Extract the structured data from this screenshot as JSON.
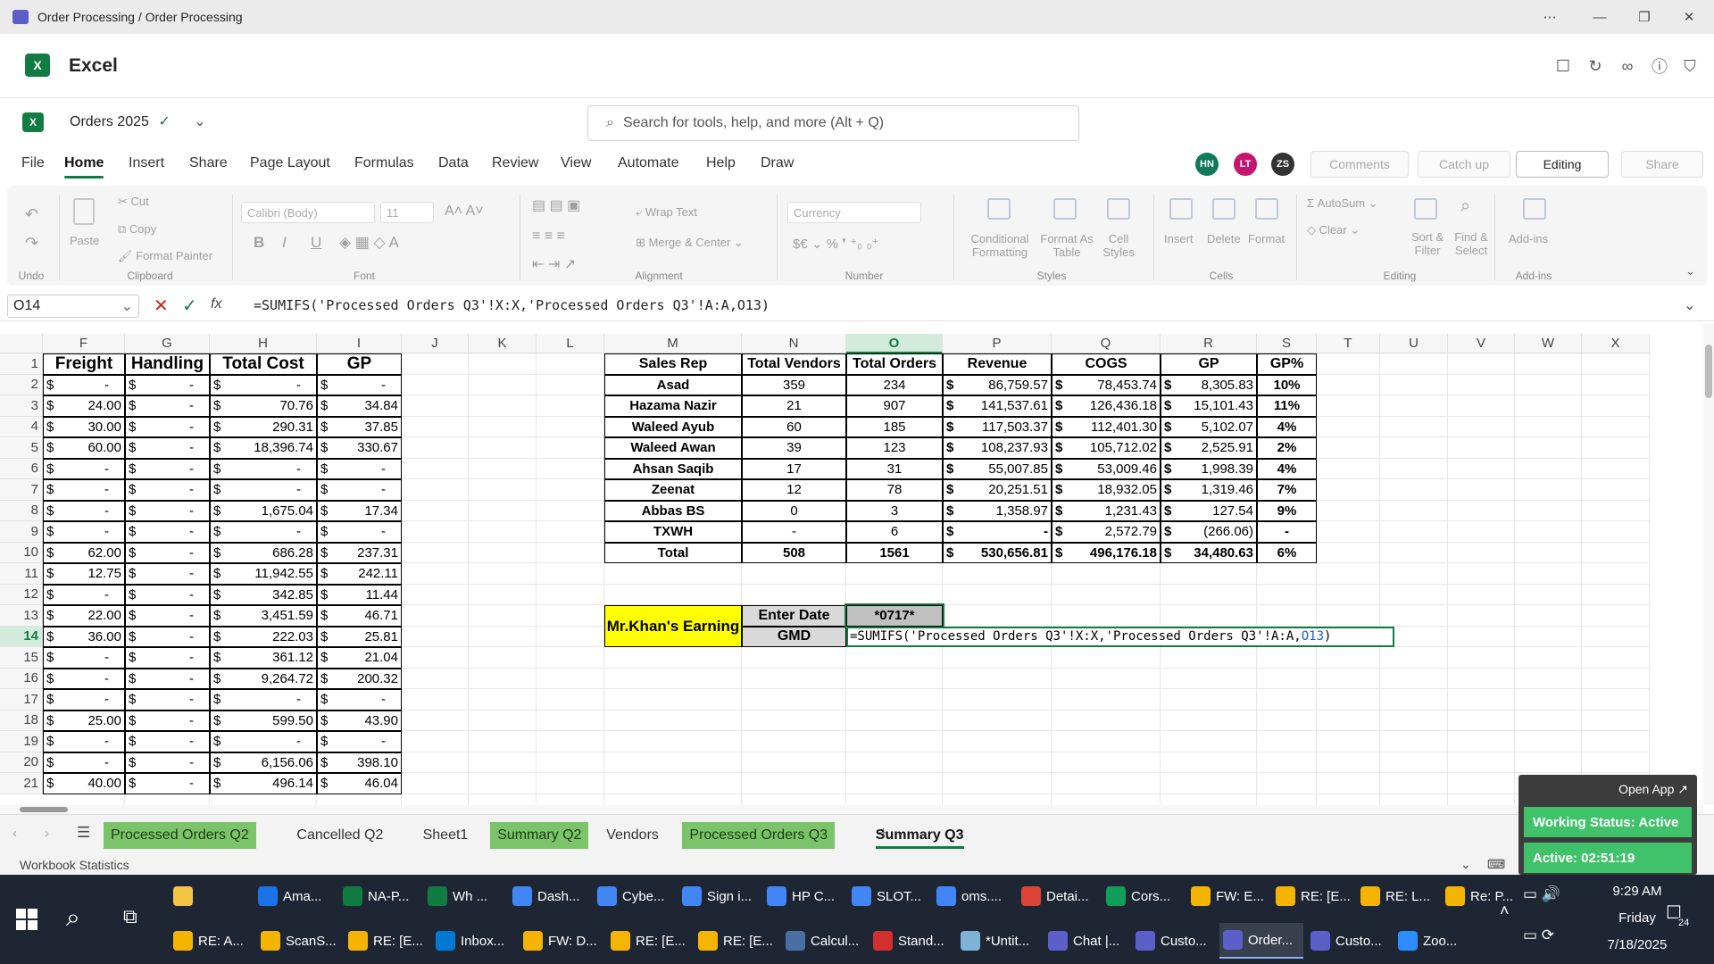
{
  "window": {
    "title": "Order Processing / Order Processing"
  },
  "app": {
    "name": "Excel",
    "doc_name": "Orders 2025",
    "search_placeholder": "Search for tools, help, and more (Alt + Q)"
  },
  "menu": [
    "File",
    "Home",
    "Insert",
    "Share",
    "Page Layout",
    "Formulas",
    "Data",
    "Review",
    "View",
    "Automate",
    "Help",
    "Draw"
  ],
  "avatars": [
    {
      "initials": "HN",
      "color": "#0e7a5a"
    },
    {
      "initials": "LT",
      "color": "#c4166e"
    },
    {
      "initials": "ZS",
      "color": "#333333"
    }
  ],
  "top_buttons": {
    "comments": "Comments",
    "catch_up": "Catch up",
    "editing": "Editing",
    "share": "Share"
  },
  "ribbon": {
    "undo": "Undo",
    "paste": "Paste",
    "cut": "Cut",
    "copy": "Copy",
    "format_painter": "Format Painter",
    "clipboard": "Clipboard",
    "font_name": "Calibri (Body)",
    "font_size": "11",
    "font": "Font",
    "wrap_text": "Wrap Text",
    "merge_center": "Merge & Center",
    "alignment": "Alignment",
    "number_format": "Currency",
    "number": "Number",
    "conditional": "Conditional",
    "formatting": "Formatting",
    "format_as": "Format As",
    "table": "Table",
    "cell": "Cell",
    "styles_btn": "Styles",
    "styles": "Styles",
    "insert": "Insert",
    "delete": "Delete",
    "format": "Format",
    "cells": "Cells",
    "autosum": "AutoSum",
    "clear": "Clear",
    "sort": "Sort &",
    "filter": "Filter",
    "find": "Find &",
    "select": "Select",
    "editing": "Editing",
    "addins": "Add-ins",
    "addins_group": "Add-ins"
  },
  "formula_bar": {
    "name_box": "O14",
    "fx": "fx",
    "formula": "=SUMIFS('Processed Orders Q3'!X:X,'Processed Orders Q3'!A:A,O13)"
  },
  "columns": [
    "F",
    "G",
    "H",
    "I",
    "J",
    "K",
    "L",
    "M",
    "N",
    "O",
    "P",
    "Q",
    "R",
    "S",
    "T",
    "U",
    "V",
    "W",
    "X"
  ],
  "rows": [
    "1",
    "2",
    "3",
    "4",
    "5",
    "6",
    "7",
    "8",
    "9",
    "10",
    "11",
    "12",
    "13",
    "14",
    "15",
    "16",
    "17",
    "18",
    "19",
    "20",
    "21"
  ],
  "left_table": {
    "headers": [
      "Freight",
      "Handling",
      "Total Cost",
      "GP"
    ],
    "rows": [
      [
        "-",
        "-",
        "-",
        "-"
      ],
      [
        "24.00",
        "-",
        "70.76",
        "34.84"
      ],
      [
        "30.00",
        "-",
        "290.31",
        "37.85"
      ],
      [
        "60.00",
        "-",
        "18,396.74",
        "330.67"
      ],
      [
        "-",
        "-",
        "-",
        "-"
      ],
      [
        "-",
        "-",
        "-",
        "-"
      ],
      [
        "-",
        "-",
        "1,675.04",
        "17.34"
      ],
      [
        "-",
        "-",
        "-",
        "-"
      ],
      [
        "62.00",
        "-",
        "686.28",
        "237.31"
      ],
      [
        "12.75",
        "-",
        "11,942.55",
        "242.11"
      ],
      [
        "-",
        "-",
        "342.85",
        "11.44"
      ],
      [
        "22.00",
        "-",
        "3,451.59",
        "46.71"
      ],
      [
        "36.00",
        "-",
        "222.03",
        "25.81"
      ],
      [
        "-",
        "-",
        "361.12",
        "21.04"
      ],
      [
        "-",
        "-",
        "9,264.72",
        "200.32"
      ],
      [
        "-",
        "-",
        "-",
        "-"
      ],
      [
        "25.00",
        "-",
        "599.50",
        "43.90"
      ],
      [
        "-",
        "-",
        "-",
        "-"
      ],
      [
        "-",
        "-",
        "6,156.06",
        "398.10"
      ],
      [
        "40.00",
        "-",
        "496.14",
        "46.04"
      ]
    ]
  },
  "currency_symbol": "$",
  "summary": {
    "headers": [
      "Sales Rep",
      "Total Vendors",
      "Total Orders",
      "Revenue",
      "COGS",
      "GP",
      "GP%"
    ],
    "rows": [
      [
        "Asad",
        "359",
        "234",
        "86,759.57",
        "78,453.74",
        "8,305.83",
        "10%"
      ],
      [
        "Hazama Nazir",
        "21",
        "907",
        "141,537.61",
        "126,436.18",
        "15,101.43",
        "11%"
      ],
      [
        "Waleed Ayub",
        "60",
        "185",
        "117,503.37",
        "112,401.30",
        "5,102.07",
        "4%"
      ],
      [
        "Waleed Awan",
        "39",
        "123",
        "108,237.93",
        "105,712.02",
        "2,525.91",
        "2%"
      ],
      [
        "Ahsan Saqib",
        "17",
        "31",
        "55,007.85",
        "53,009.46",
        "1,998.39",
        "4%"
      ],
      [
        "Zeenat",
        "12",
        "78",
        "20,251.51",
        "18,932.05",
        "1,319.46",
        "7%"
      ],
      [
        "Abbas BS",
        "0",
        "3",
        "1,358.97",
        "1,231.43",
        "127.54",
        "9%"
      ],
      [
        "TXWH",
        "-",
        "6",
        "-",
        "2,572.79",
        "(266.06)",
        "-"
      ],
      [
        "Total",
        "508",
        "1561",
        "530,656.81",
        "496,176.18",
        "34,480.63",
        "6%"
      ]
    ]
  },
  "earning": {
    "label": "Mr.Khan's Earning",
    "enter_date": "Enter Date",
    "date_value": "*0717*",
    "gmd": "GMD",
    "edit_formula_a": "=SUMIFS('Processed Orders Q3'!X:X,'Processed Orders Q3'!A:A,",
    "edit_formula_b": "O13",
    ")": ")"
  },
  "sheet_tabs": [
    {
      "label": "Processed Orders Q2",
      "green": true
    },
    {
      "label": "Cancelled Q2",
      "green": false
    },
    {
      "label": "Sheet1",
      "green": false
    },
    {
      "label": "Summary Q2",
      "green": true
    },
    {
      "label": "Vendors",
      "green": false
    },
    {
      "label": "Processed Orders Q3",
      "green": true
    },
    {
      "label": "Summary Q3",
      "green": false,
      "active": true
    }
  ],
  "status": {
    "left": "Workbook Statistics"
  },
  "widget": {
    "open_app": "Open App",
    "working": "Working Status: Active",
    "active": "Active: 02:51:19"
  },
  "taskbar": {
    "row1": [
      {
        "label": "",
        "color": "#f4c542"
      },
      {
        "label": "Ama...",
        "color": "#1a73e8"
      },
      {
        "label": "NA-P...",
        "color": "#107c41"
      },
      {
        "label": "Wh ...",
        "color": "#107c41"
      },
      {
        "label": "Dash...",
        "color": "#4285f4"
      },
      {
        "label": "Cybe...",
        "color": "#4285f4"
      },
      {
        "label": "Sign i...",
        "color": "#4285f4"
      },
      {
        "label": "HP C...",
        "color": "#4285f4"
      },
      {
        "label": "SLOT...",
        "color": "#4285f4"
      },
      {
        "label": "oms....",
        "color": "#4285f4"
      },
      {
        "label": "Detai...",
        "color": "#db4437"
      },
      {
        "label": "Cors...",
        "color": "#0f9d58"
      },
      {
        "label": "FW: E...",
        "color": "#f4b400"
      },
      {
        "label": "RE: [E...",
        "color": "#f4b400"
      },
      {
        "label": "RE: L...",
        "color": "#f4b400"
      },
      {
        "label": "Re: P...",
        "color": "#f4b400"
      }
    ],
    "row2": [
      {
        "label": "RE: A...",
        "color": "#f4b400"
      },
      {
        "label": "ScanS...",
        "color": "#f4b400"
      },
      {
        "label": "RE: [E...",
        "color": "#f4b400"
      },
      {
        "label": "Inbox...",
        "color": "#0078d4"
      },
      {
        "label": "FW: D...",
        "color": "#f4b400"
      },
      {
        "label": "RE: [E...",
        "color": "#f4b400"
      },
      {
        "label": "RE: [E...",
        "color": "#f4b400"
      },
      {
        "label": "Calcul...",
        "color": "#4a6fa5"
      },
      {
        "label": "Stand...",
        "color": "#d32f2f"
      },
      {
        "label": "*Untit...",
        "color": "#7fb3d5"
      },
      {
        "label": "Chat |...",
        "color": "#5b5fc7"
      },
      {
        "label": "Custo...",
        "color": "#5b5fc7"
      },
      {
        "label": "Order...",
        "color": "#5b5fc7",
        "active": true
      },
      {
        "label": "Custo...",
        "color": "#5b5fc7"
      },
      {
        "label": "Zoo...",
        "color": "#2d8cff"
      }
    ],
    "time": "9:29 AM",
    "day": "Friday",
    "date": "7/18/2025",
    "notif": "24"
  }
}
